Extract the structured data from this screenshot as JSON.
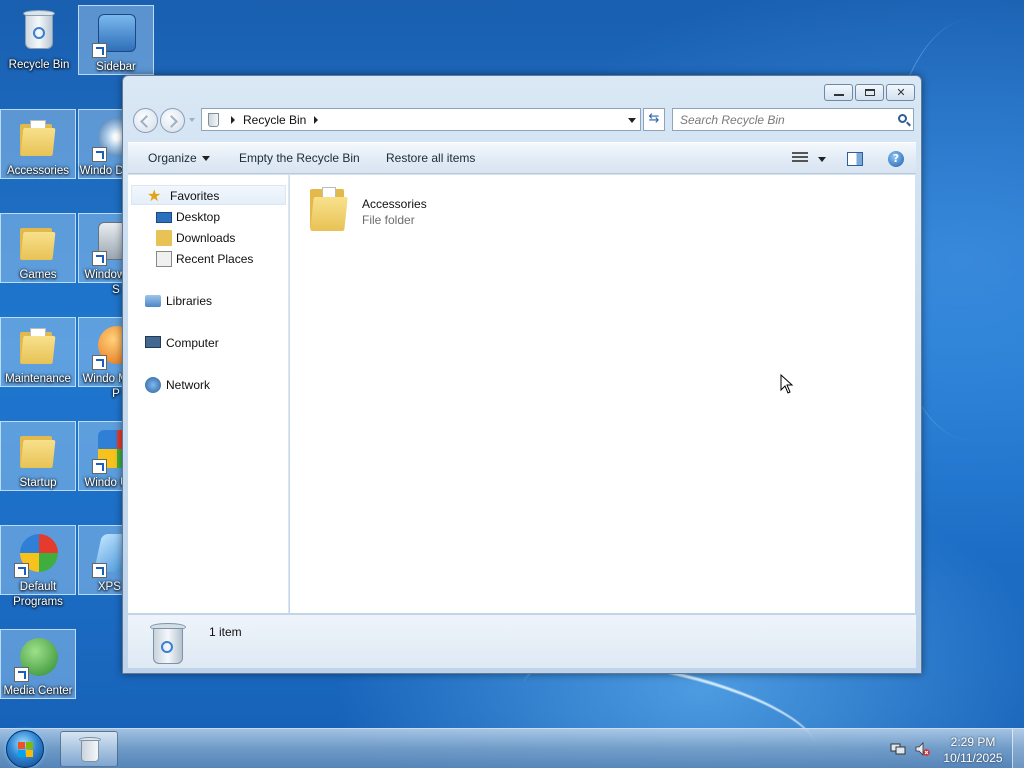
{
  "desktop": {
    "icons": [
      {
        "label": "Recycle Bin"
      },
      {
        "label": "Sidebar"
      },
      {
        "label": "Accessories"
      },
      {
        "label": "Windo DVD M"
      },
      {
        "label": "Games"
      },
      {
        "label": "Window and S"
      },
      {
        "label": "Maintenance"
      },
      {
        "label": "Windo Media P"
      },
      {
        "label": "Startup"
      },
      {
        "label": "Windo Upda"
      },
      {
        "label": "Default Programs"
      },
      {
        "label": "XPS Vi"
      },
      {
        "label": "Media Center"
      }
    ]
  },
  "window": {
    "address": {
      "location": "Recycle Bin"
    },
    "search": {
      "placeholder": "Search Recycle Bin"
    },
    "toolbar": {
      "organize": "Organize",
      "empty": "Empty the Recycle Bin",
      "restore": "Restore all items"
    },
    "navpane": {
      "favorites": "Favorites",
      "desktop": "Desktop",
      "downloads": "Downloads",
      "recent": "Recent Places",
      "libraries": "Libraries",
      "computer": "Computer",
      "network": "Network"
    },
    "items": [
      {
        "name": "Accessories",
        "type": "File folder"
      }
    ],
    "details": {
      "count": "1 item"
    }
  },
  "taskbar": {
    "time": "2:29 PM",
    "date": "10/11/2025"
  },
  "icons": {
    "start": "windows-start-orb",
    "task_recycle": "recycle-bin-icon",
    "tray_network": "network-icon",
    "tray_volume": "volume-muted-icon"
  }
}
